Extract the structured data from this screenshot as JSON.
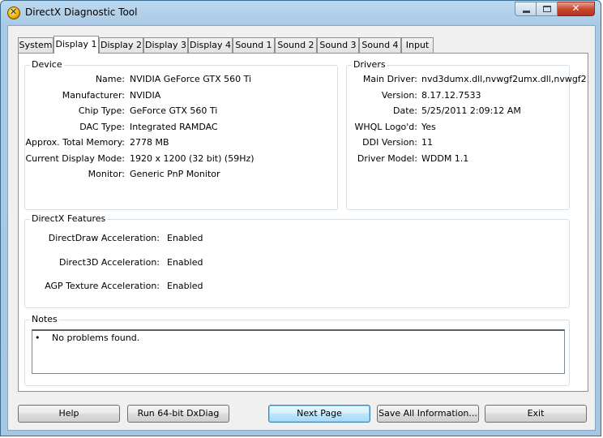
{
  "window": {
    "title": "DirectX Diagnostic Tool",
    "minimize_label": "",
    "maximize_label": "",
    "close_label": "✕"
  },
  "tabs": [
    {
      "label": "System"
    },
    {
      "label": "Display 1"
    },
    {
      "label": "Display 2"
    },
    {
      "label": "Display 3"
    },
    {
      "label": "Display 4"
    },
    {
      "label": "Sound 1"
    },
    {
      "label": "Sound 2"
    },
    {
      "label": "Sound 3"
    },
    {
      "label": "Sound 4"
    },
    {
      "label": "Input"
    }
  ],
  "active_tab": "Display 1",
  "device": {
    "title": "Device",
    "rows": [
      {
        "label": "Name:",
        "value": "NVIDIA GeForce GTX 560 Ti"
      },
      {
        "label": "Manufacturer:",
        "value": "NVIDIA"
      },
      {
        "label": "Chip Type:",
        "value": "GeForce GTX 560 Ti"
      },
      {
        "label": "DAC Type:",
        "value": "Integrated RAMDAC"
      },
      {
        "label": "Approx. Total Memory:",
        "value": "2778 MB"
      },
      {
        "label": "Current Display Mode:",
        "value": "1920 x 1200 (32 bit) (59Hz)"
      },
      {
        "label": "Monitor:",
        "value": "Generic PnP Monitor"
      }
    ]
  },
  "drivers": {
    "title": "Drivers",
    "rows": [
      {
        "label": "Main Driver:",
        "value": "nvd3dumx.dll,nvwgf2umx.dll,nvwgf2"
      },
      {
        "label": "Version:",
        "value": "8.17.12.7533"
      },
      {
        "label": "Date:",
        "value": "5/25/2011 2:09:12 AM"
      },
      {
        "label": "WHQL Logo'd:",
        "value": "Yes"
      },
      {
        "label": "DDI Version:",
        "value": "11"
      },
      {
        "label": "Driver Model:",
        "value": "WDDM 1.1"
      }
    ]
  },
  "features": {
    "title": "DirectX Features",
    "rows": [
      {
        "label": "DirectDraw Acceleration:",
        "value": "Enabled"
      },
      {
        "label": "Direct3D Acceleration:",
        "value": "Enabled"
      },
      {
        "label": "AGP Texture Acceleration:",
        "value": "Enabled"
      }
    ]
  },
  "notes": {
    "title": "Notes",
    "bullet": "•",
    "items": [
      "No problems found."
    ]
  },
  "buttons": {
    "help": "Help",
    "run64": "Run 64-bit DxDiag",
    "next_page": "Next Page",
    "save_all": "Save All Information...",
    "exit": "Exit"
  },
  "colors": {
    "title_bar": "#a9c9e4",
    "close_button": "#c9482f",
    "default_button_border": "#3c7fb1"
  }
}
